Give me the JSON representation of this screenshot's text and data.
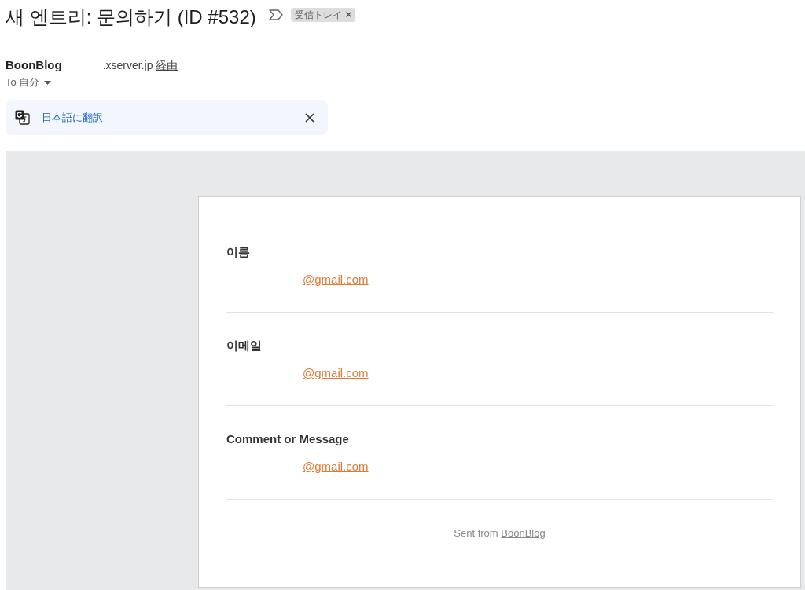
{
  "subject": {
    "title": "새 엔트리: 문의하기 (ID #532)",
    "important": false,
    "labels": [
      {
        "text": "受信トレイ"
      }
    ]
  },
  "sender": {
    "name": "BoonBlog",
    "via_domain": ".xserver.jp",
    "via_link": "経由"
  },
  "recipient": {
    "text": "To 自分"
  },
  "translate_bar": {
    "link": "日本語に翻訳"
  },
  "message": {
    "fields": [
      {
        "label": "이름",
        "value": "@gmail.com"
      },
      {
        "label": "이메일",
        "value": "@gmail.com"
      },
      {
        "label": "Comment or Message",
        "value": "@gmail.com"
      }
    ],
    "footer": {
      "text": "Sent from",
      "link": "BoonBlog"
    }
  }
}
